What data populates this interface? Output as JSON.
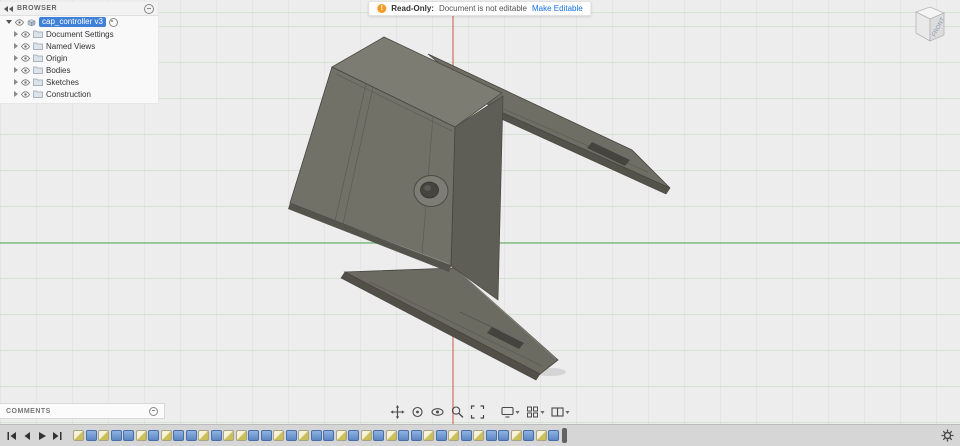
{
  "banner": {
    "icon_glyph": "!",
    "label": "Read-Only:",
    "message": "Document is not editable",
    "action": "Make Editable"
  },
  "browser": {
    "title": "BROWSER",
    "document": {
      "label": "cap_controller v3"
    },
    "items": [
      {
        "label": "Document Settings"
      },
      {
        "label": "Named Views"
      },
      {
        "label": "Origin"
      },
      {
        "label": "Bodies"
      },
      {
        "label": "Sketches"
      },
      {
        "label": "Construction"
      }
    ]
  },
  "comments": {
    "title": "COMMENTS"
  },
  "viewcube": {
    "front_label": "FRONT"
  },
  "navbar": {
    "buttons": [
      {
        "name": "pan"
      },
      {
        "name": "orbit"
      },
      {
        "name": "look-at"
      },
      {
        "name": "zoom"
      },
      {
        "name": "fit"
      },
      {
        "name": "display-settings",
        "has_menu": true
      },
      {
        "name": "grid-settings",
        "has_menu": true
      },
      {
        "name": "viewports",
        "has_menu": true
      }
    ]
  },
  "timeline": {
    "features": [
      "sketch",
      "solid",
      "sketch",
      "solid",
      "solid",
      "sketch",
      "solid",
      "sketch",
      "solid",
      "solid",
      "sketch",
      "solid",
      "sketch",
      "sketch",
      "solid",
      "solid",
      "sketch",
      "solid",
      "sketch",
      "solid",
      "solid",
      "sketch",
      "solid",
      "sketch",
      "solid",
      "sketch",
      "solid",
      "solid",
      "sketch",
      "solid",
      "sketch",
      "solid",
      "sketch",
      "solid",
      "solid",
      "sketch",
      "solid",
      "sketch",
      "solid"
    ]
  },
  "colors": {
    "accent": "#1a73e8",
    "warning": "#f49b26",
    "selection": "#3f80d8",
    "canvas": "#ededed",
    "axis_green": "#5faf5f",
    "axis_red": "#d2645a",
    "model_face": "#727168",
    "timeline_solid": "#6f9bd8",
    "timeline_sketch": "#e3d37f"
  }
}
